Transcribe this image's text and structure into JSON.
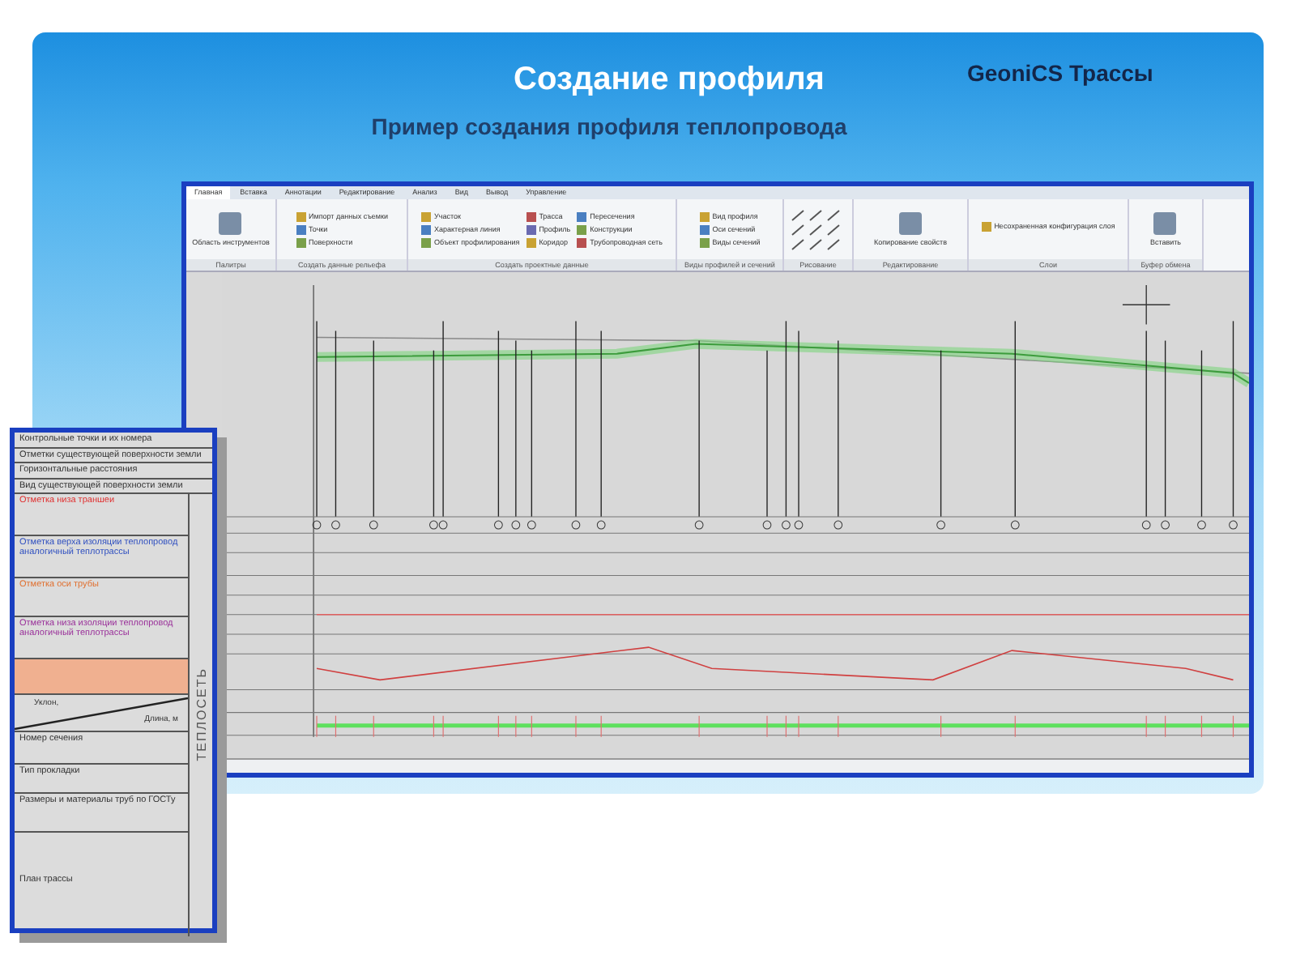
{
  "slide": {
    "title": "Создание профиля",
    "subtitle": "Пример создания профиля теплопровода",
    "brand": "GeoniCS Трассы"
  },
  "app": {
    "tabs": [
      {
        "label": "Главная",
        "selected": true
      },
      {
        "label": "Вставка",
        "selected": false
      },
      {
        "label": "Аннотации",
        "selected": false
      },
      {
        "label": "Редактирование",
        "selected": false
      },
      {
        "label": "Анализ",
        "selected": false
      },
      {
        "label": "Вид",
        "selected": false
      },
      {
        "label": "Вывод",
        "selected": false
      },
      {
        "label": "Управление",
        "selected": false
      }
    ],
    "groups": [
      {
        "label": "Палитры",
        "kind": "large",
        "items": [
          "Область инструментов"
        ]
      },
      {
        "label": "Создать данные рельефа",
        "kind": "list",
        "items": [
          "Импорт данных съемки",
          "Точки",
          "Поверхности"
        ]
      },
      {
        "label": "Создать проектные данные",
        "kind": "list",
        "items": [
          "Участок",
          "Характерная линия",
          "Объект профилирования",
          "Трасса",
          "Профиль",
          "Коридор",
          "Пересечения",
          "Конструкции",
          "Трубопроводная сеть"
        ]
      },
      {
        "label": "Виды профилей и сечений",
        "kind": "list",
        "items": [
          "Вид профиля",
          "Оси сечений",
          "Виды сечений"
        ]
      },
      {
        "label": "Рисование",
        "kind": "tools"
      },
      {
        "label": "Редактирование",
        "kind": "large",
        "items": [
          "Копирование свойств"
        ]
      },
      {
        "label": "Слои",
        "kind": "list",
        "items": [
          "Несохраненная конфигурация слоя"
        ]
      },
      {
        "label": "Буфер обмена",
        "kind": "large",
        "items": [
          "Вставить"
        ]
      }
    ]
  },
  "legend": {
    "side_label": "ТЕПЛОСЕТЬ",
    "top_rows": [
      {
        "kind": "text",
        "label": "Контрольные точки и их номера"
      },
      {
        "kind": "text",
        "label": "Отметки существующей поверхности земли"
      },
      {
        "kind": "text",
        "label": "Горизонтальные расстояния"
      },
      {
        "kind": "text",
        "label": "Вид существующей поверхности земли"
      }
    ],
    "rows": [
      {
        "kind": "text",
        "label": "Отметка низа траншеи",
        "color": "#e03030"
      },
      {
        "kind": "text",
        "label": "Отметка верха изоляции теплопровод аналогичный теплотрассы",
        "color": "#3050c0"
      },
      {
        "kind": "text",
        "label": "Отметка оси трубы",
        "color": "#e07030"
      },
      {
        "kind": "text",
        "label": "Отметка низа изоляции теплопровод аналогичный теплотрассы",
        "color": "#9a309a"
      },
      {
        "kind": "blank",
        "color": "#f0b090"
      },
      {
        "kind": "slope",
        "label": "Уклон,",
        "label_2": "Длина, м"
      },
      {
        "kind": "text",
        "label": "Номер сечения"
      },
      {
        "kind": "text",
        "label": "Тип прокладки"
      },
      {
        "kind": "text",
        "label": "Размеры и материалы труб по ГОСТу"
      },
      {
        "kind": "tall",
        "label": "План трассы"
      }
    ]
  }
}
